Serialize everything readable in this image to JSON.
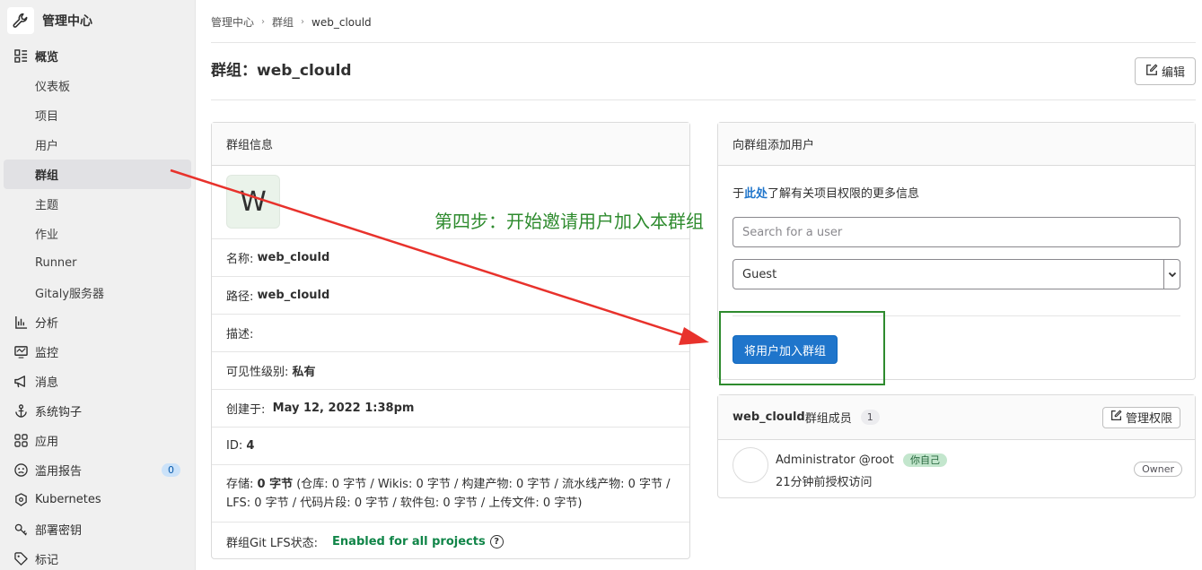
{
  "sidebar": {
    "header": "管理中心",
    "overview": "概览",
    "sub_items": [
      "仪表板",
      "项目",
      "用户",
      "群组",
      "主题",
      "作业",
      "Runner",
      "Gitaly服务器"
    ],
    "items": [
      {
        "label": "分析",
        "icon": "chart-icon"
      },
      {
        "label": "监控",
        "icon": "monitor-icon"
      },
      {
        "label": "消息",
        "icon": "megaphone-icon"
      },
      {
        "label": "系统钩子",
        "icon": "anchor-icon"
      },
      {
        "label": "应用",
        "icon": "grid-icon"
      },
      {
        "label": "滥用报告",
        "icon": "abuse-icon",
        "badge": "0"
      },
      {
        "label": "Kubernetes",
        "icon": "kubernetes-icon"
      },
      {
        "label": "部署密钥",
        "icon": "key-icon"
      },
      {
        "label": "标记",
        "icon": "label-icon"
      }
    ]
  },
  "breadcrumb": [
    "管理中心",
    "群组",
    "web_clould"
  ],
  "page": {
    "title_prefix": "群组：",
    "title_name": "web_clould",
    "edit_label": "编辑"
  },
  "group_info": {
    "header": "群组信息",
    "avatar_letter": "W",
    "name_label": "名称: ",
    "name_value": "web_clould",
    "path_label": "路径: ",
    "path_value": "web_clould",
    "desc_label": "描述:",
    "visibility_label": "可见性级别: ",
    "visibility_value": "私有",
    "created_label": "创建于: ",
    "created_value": "May 12, 2022 1:38pm",
    "id_label": "ID: ",
    "id_value": "4",
    "storage_label": "存储: ",
    "storage_value": "0 字节",
    "storage_detail": " (仓库: 0 字节 / Wikis: 0 字节 / 构建产物: 0 字节 / 流水线产物: 0 字节 / LFS: 0 字节 / 代码片段: 0 字节 / 软件包: 0 字节 / 上传文件: 0 字节)",
    "lfs_label": "群组Git LFS状态:",
    "lfs_value": "Enabled for all projects"
  },
  "add_user": {
    "header": "向群组添加用户",
    "perm_prefix": "于",
    "perm_link": "此处",
    "perm_suffix": "了解有关项目权限的更多信息",
    "search_placeholder": "Search for a user",
    "role_value": "Guest",
    "submit_label": "将用户加入群组"
  },
  "members": {
    "title_name": "web_clould",
    "title_suffix": "群组成员",
    "count": "1",
    "manage_label": "管理权限",
    "list": [
      {
        "name": "Administrator",
        "username": "@root",
        "you_badge": "你自己",
        "access": "21分钟前授权访问",
        "role": "Owner"
      }
    ]
  },
  "annotation": {
    "step_text": "第四步：开始邀请用户加入本群组",
    "colors": {
      "arrow": "#e8322c",
      "step_text": "#2e8b2e",
      "box": "#2e8b2e"
    }
  }
}
